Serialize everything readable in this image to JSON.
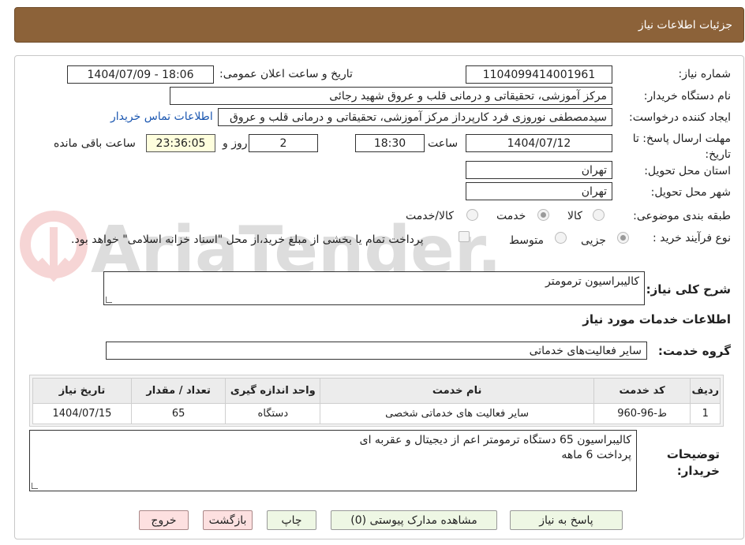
{
  "header": {
    "title": "جزئیات اطلاعات نیاز"
  },
  "form": {
    "need_number_label": "شماره نیاز:",
    "need_number": "1104099414001961",
    "announce_label": "تاریخ و ساعت اعلان عمومی:",
    "announce_value": "1404/07/09 - 18:06",
    "buyer_org_label": "نام دستگاه خریدار:",
    "buyer_org": "مرکز آموزشی، تحقیقاتی و درمانی قلب و عروق شهید رجائی",
    "requester_label": "ایجاد کننده درخواست:",
    "requester": "سیدمصطفی نوروزی فرد کارپرداز مرکز آموزشی، تحقیقاتی و درمانی قلب و عروق",
    "contact_link": "اطلاعات تماس خریدار",
    "deadline_label": "مهلت ارسال پاسخ: تا تاریخ:",
    "deadline_date": "1404/07/12",
    "time_label": "ساعت",
    "deadline_time": "18:30",
    "days_value": "2",
    "days_label": "روز و",
    "remaining_time": "23:36:05",
    "remaining_label": "ساعت باقی مانده",
    "province_label": "استان محل تحویل:",
    "province": "تهران",
    "city_label": "شهر محل تحویل:",
    "city": "تهران",
    "category_label": "طبقه بندی موضوعی:",
    "category_options": [
      "کالا",
      "خدمت",
      "کالا/خدمت"
    ],
    "category_selected": "خدمت",
    "process_label": "نوع فرآیند خرید :",
    "process_options": [
      "جزیی",
      "متوسط"
    ],
    "process_selected": "جزیی",
    "payment_note": "پرداخت تمام یا بخشی از مبلغ خرید،از محل \"اسناد خزانه اسلامی\" خواهد بود."
  },
  "summary": {
    "label": "شرح کلی نیاز:",
    "value": "کالیبراسیون ترمومتر"
  },
  "services": {
    "section_title": "اطلاعات خدمات مورد نیاز",
    "group_label": "گروه خدمت:",
    "group_value": "سایر فعالیت‌های خدماتی",
    "columns": [
      "ردیف",
      "کد خدمت",
      "نام خدمت",
      "واحد اندازه گیری",
      "تعداد / مقدار",
      "تاریخ نیاز"
    ],
    "rows": [
      [
        "1",
        "ط-96-960",
        "سایر فعالیت های خدماتی شخصی",
        "دستگاه",
        "65",
        "1404/07/15"
      ]
    ]
  },
  "notes": {
    "label": "توضیحات خریدار:",
    "line1": "کالیبراسیون 65 دستگاه ترمومتر اعم از دیجیتال و عقربه ای",
    "line2": "پرداخت 6 ماهه"
  },
  "buttons": {
    "reply": "پاسخ به نیاز",
    "attachments": "مشاهده مدارک پیوستی (0)",
    "print": "چاپ",
    "back": "بازگشت",
    "exit": "خروج"
  },
  "watermark": {
    "text": "AriaTender.neT"
  },
  "colors": {
    "header_bg": "#8c6239",
    "link": "#1a56b0",
    "highlight": "#fefedd"
  }
}
